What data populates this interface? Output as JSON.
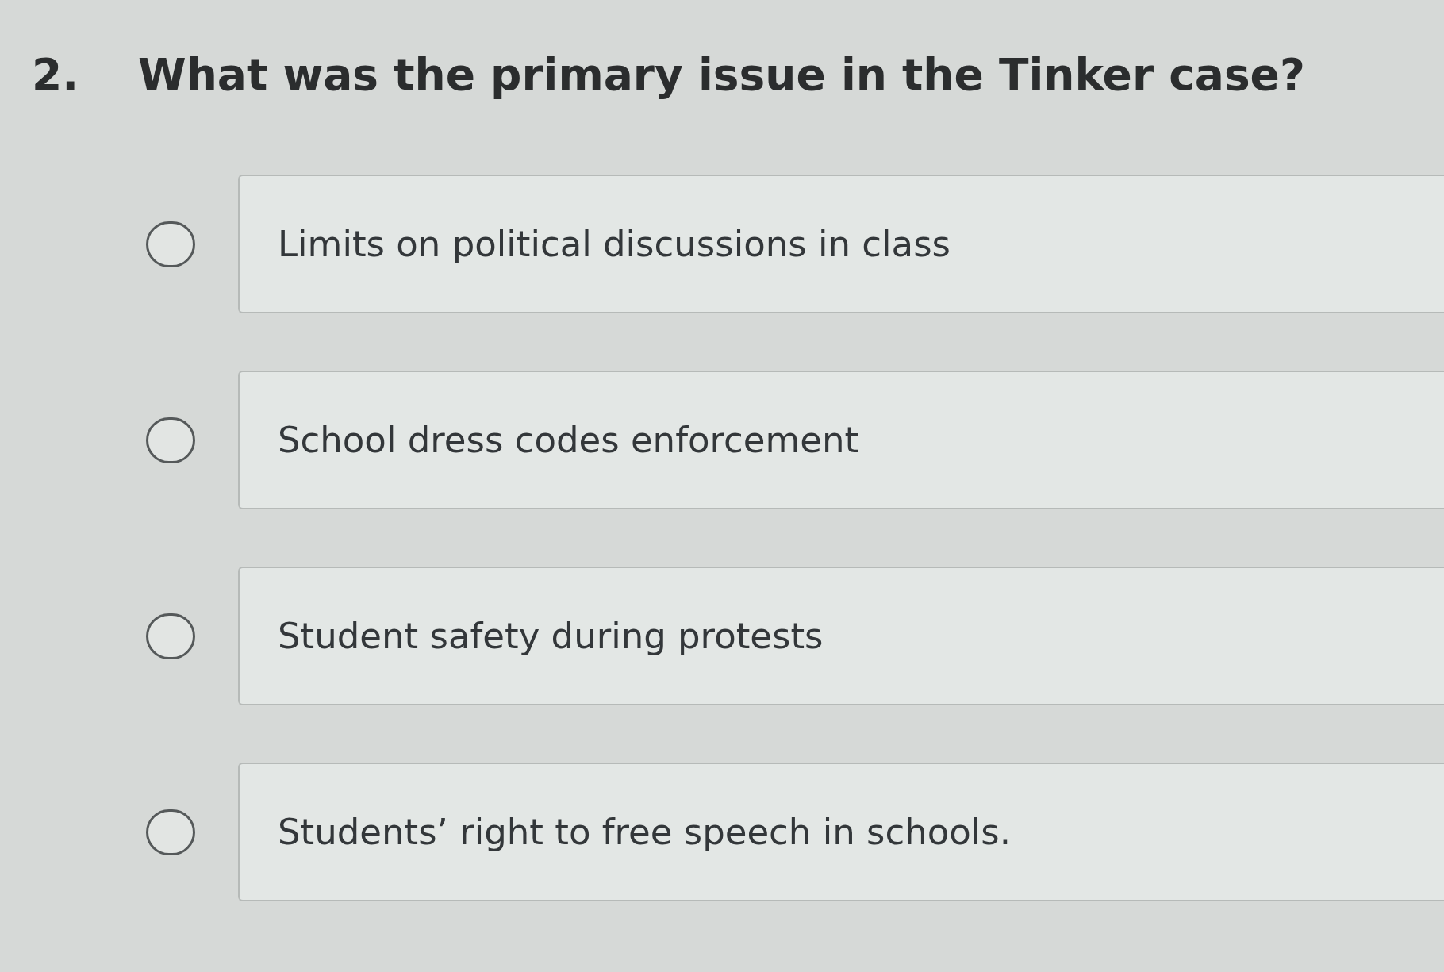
{
  "question": {
    "number": "2.",
    "text": "What was the primary issue in the Tinker case?"
  },
  "options": [
    {
      "label": "Limits on political discussions in class",
      "selected": false
    },
    {
      "label": "School dress codes enforcement",
      "selected": false
    },
    {
      "label": "Student safety during protests",
      "selected": false
    },
    {
      "label": "Students’ right to free speech in schools.",
      "selected": false
    }
  ]
}
